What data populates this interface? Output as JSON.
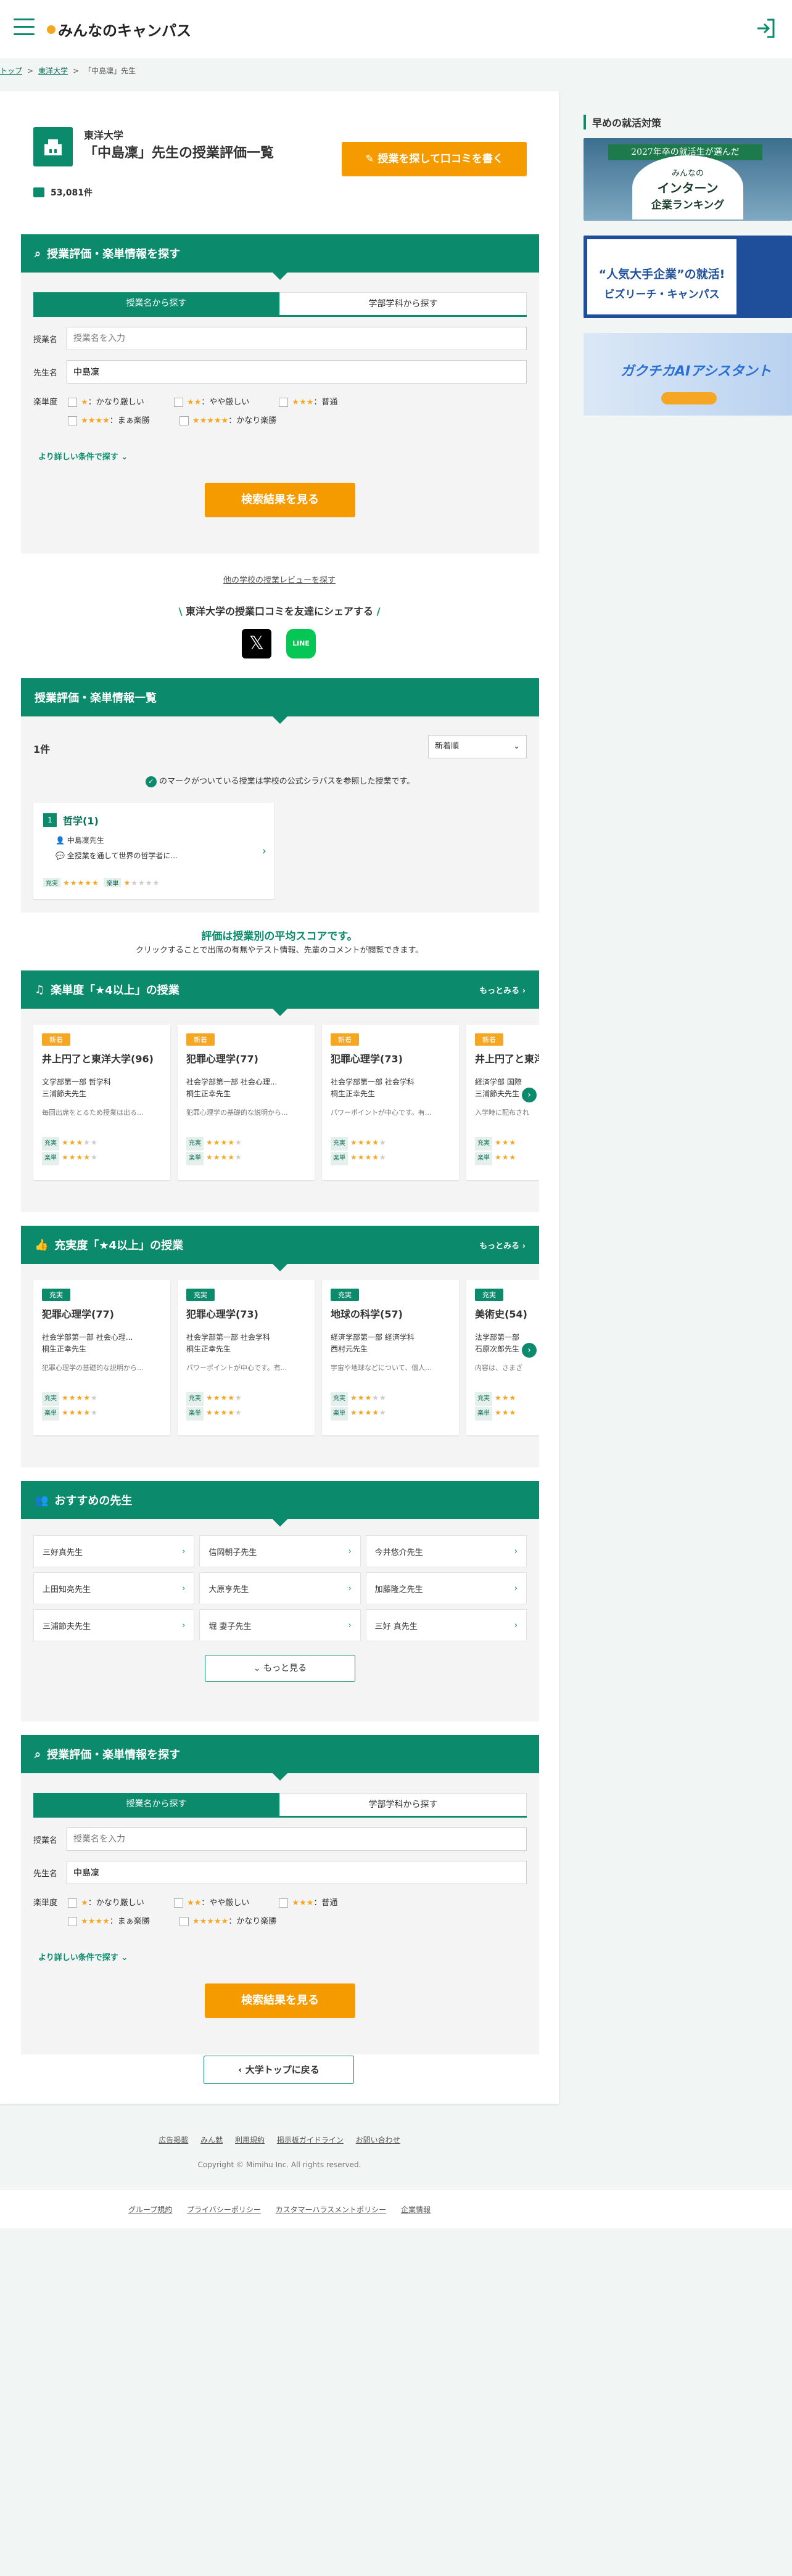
{
  "header": {
    "logo": "みんなのキャンパス"
  },
  "breadcrumb": [
    "トップ",
    "東洋大学",
    "「中島凜」先生"
  ],
  "teacher": {
    "university": "東洋大学",
    "title": "「中島凜」先生の授業評価一覧",
    "count": "53,081件",
    "review_button": "授業を探して口コミを書く"
  },
  "search": {
    "heading": "授業評価・楽単情報を探す",
    "tab1": "授業名から探す",
    "tab2": "学部学科から探す",
    "course_label": "授業名",
    "course_placeholder": "授業名を入力",
    "teacher_label": "先生名",
    "teacher_value": "中島凜",
    "rate_label": "楽単度",
    "opts": [
      {
        "stars": "★",
        "text": "：かなり厳しい"
      },
      {
        "stars": "★★",
        "text": "：やや厳しい"
      },
      {
        "stars": "★★★",
        "text": "：普通"
      },
      {
        "stars": "★★★★",
        "text": "：まぁ楽勝"
      },
      {
        "stars": "★★★★★",
        "text": "：かなり楽勝"
      }
    ],
    "more": "より詳しい条件で探す",
    "submit": "検索結果を見る"
  },
  "other_link": "他の学校の授業レビューを探す",
  "share": {
    "title": "東洋大学の授業口コミを友達にシェアする",
    "line": "LINE"
  },
  "list": {
    "heading": "授業評価・楽単情報一覧",
    "count": "1件",
    "sort": "新着順",
    "note": "のマークがついている授業は学校の公式シラバスを参照した授業です。",
    "item": {
      "rank": "1",
      "name": "哲学(1)",
      "teacher": "中島凜先生",
      "desc": "全授業を通して世界の哲学者に...",
      "l1": "充実",
      "s1": "★★★★★",
      "l2": "楽単",
      "s2": "★",
      "s2e": "★★★★"
    }
  },
  "avg": {
    "title": "評価は授業別の平均スコアです。",
    "sub": "クリックすることで出席の有無やテスト情報、先輩のコメントが閲覧できます。"
  },
  "raku": {
    "heading": "楽単度「★4以上」の授業",
    "more": "もっとみる",
    "cards": [
      {
        "tag": "新着",
        "title": "井上円了と東洋大学(96)",
        "dept": "文学部第一部 哲学科",
        "teacher": "三浦節夫先生",
        "desc": "毎回出席をとるため授業は出る...",
        "s1": "★★★",
        "s1e": "★★",
        "s2": "★★★★",
        "s2e": "★"
      },
      {
        "tag": "新着",
        "title": "犯罪心理学(77)",
        "dept": "社会学部第一部 社会心理...",
        "teacher": "桐生正幸先生",
        "desc": "犯罪心理学の基礎的な説明から...",
        "s1": "★★★★",
        "s1e": "★",
        "s2": "★★★★",
        "s2e": "★"
      },
      {
        "tag": "新着",
        "title": "犯罪心理学(73)",
        "dept": "社会学部第一部 社会学科",
        "teacher": "桐生正幸先生",
        "desc": "パワーポイントが中心です。有...",
        "s1": "★★★★",
        "s1e": "★",
        "s2": "★★★★",
        "s2e": "★"
      },
      {
        "tag": "新着",
        "title": "井上円了と東洋",
        "dept": "経済学部 国際",
        "teacher": "三浦節夫先生",
        "desc": "入学時に配布され",
        "s1": "★★★",
        "s1e": "",
        "s2": "★★★",
        "s2e": ""
      }
    ]
  },
  "juu": {
    "heading": "充実度「★4以上」の授業",
    "more": "もっとみる",
    "cards": [
      {
        "tag": "充実",
        "title": "犯罪心理学(77)",
        "dept": "社会学部第一部 社会心理...",
        "teacher": "桐生正幸先生",
        "desc": "犯罪心理学の基礎的な説明から...",
        "s1": "★★★★",
        "s1e": "★",
        "s2": "★★★★",
        "s2e": "★"
      },
      {
        "tag": "充実",
        "title": "犯罪心理学(73)",
        "dept": "社会学部第一部 社会学科",
        "teacher": "桐生正幸先生",
        "desc": "パワーポイントが中心です。有...",
        "s1": "★★★★",
        "s1e": "★",
        "s2": "★★★★",
        "s2e": "★"
      },
      {
        "tag": "充実",
        "title": "地球の科学(57)",
        "dept": "経済学部第一部 経済学科",
        "teacher": "西村元先生",
        "desc": "宇宙や地球などについて、個人...",
        "s1": "★★★",
        "s1e": "★★",
        "s2": "★★★★",
        "s2e": "★"
      },
      {
        "tag": "充実",
        "title": "美術史(54)",
        "dept": "法学部第一部",
        "teacher": "石原次郎先生",
        "desc": "内容は、さまざ",
        "s1": "★★★",
        "s1e": "",
        "s2": "★★★",
        "s2e": ""
      }
    ]
  },
  "teachers": {
    "heading": "おすすめの先生",
    "items": [
      "三好真先生",
      "信岡朝子先生",
      "今井悠介先生",
      "上田知亮先生",
      "大原亨先生",
      "加藤隆之先生",
      "三浦節夫先生",
      "堀 妻子先生",
      "三好 真先生"
    ],
    "more": "もっと見る"
  },
  "back": "大学トップに戻る",
  "side": {
    "title": "早めの就活対策",
    "b1_ribbon": "2027年卒の就活生が選んだ",
    "b1_a": "みんなの",
    "b1_b": "インターン",
    "b1_c": "企業ランキング",
    "b2_a": "“人気大手企業”の就活!",
    "b2_b": "ビズリーチ・キャンパス",
    "b3_a": "ガクチカAIアシスタント"
  },
  "footer": {
    "links1": [
      "広告掲載",
      "みん就",
      "利用規約",
      "掲示板ガイドライン",
      "お問い合わせ"
    ],
    "copy": "Copyright © Mimihu Inc. All rights reserved.",
    "links2": [
      "グループ規約",
      "プライバシーポリシー",
      "カスタマーハラスメントポリシー",
      "企業情報"
    ]
  }
}
